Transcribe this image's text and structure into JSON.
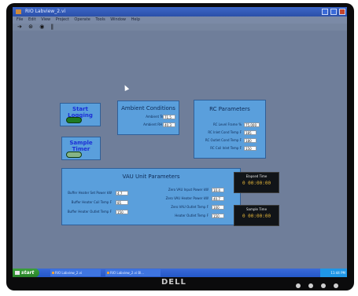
{
  "window": {
    "title": "RIO Labview_2.vi"
  },
  "menubar": [
    "File",
    "Edit",
    "View",
    "Project",
    "Operate",
    "Tools",
    "Window",
    "Help"
  ],
  "toolbar": [
    "➔",
    "⊛",
    "◉",
    "‖"
  ],
  "start_logging": {
    "label": "Start Logging",
    "state": true
  },
  "sample_timer": {
    "label": "Sample Timer",
    "state": false
  },
  "ambient": {
    "title": "Ambient Conditions",
    "rows": [
      {
        "label": "Ambient Temp",
        "value": "71.5"
      },
      {
        "label": "Ambient RH",
        "value": "40.3"
      }
    ]
  },
  "rc": {
    "title": "RC Parameters",
    "rows": [
      {
        "label": "RC Level Frame %",
        "value": "75.000"
      },
      {
        "label": "RC Inlet Cond Temp F",
        "value": "185"
      },
      {
        "label": "RC Outlet Cond Temp F",
        "value": "180"
      },
      {
        "label": "RC Coil Inlet Temp F",
        "value": "150"
      }
    ]
  },
  "vau": {
    "title": "VAU Unit Parameters",
    "left_rows": [
      {
        "label": "Buffer Heater Set Power kW",
        "value": "4.7"
      },
      {
        "label": "Buffer Heater Coil Temp F",
        "value": "85"
      },
      {
        "label": "Buffer Heater Outlet Temp F",
        "value": "150"
      }
    ],
    "right_rows": [
      {
        "label": "Zero VAU Input Power kW",
        "value": "10.4"
      },
      {
        "label": "Zero VAU Heater Power kW",
        "value": "40.7"
      },
      {
        "label": "Zero VAU Outlet Temp F",
        "value": "100"
      },
      {
        "label": "Heater Outlet Temp F",
        "value": "150"
      }
    ]
  },
  "elapsed": {
    "label": "Elapsed Time",
    "value": "0 00:00:00"
  },
  "sample": {
    "label": "Sample Time",
    "value": "0 00:00:00"
  },
  "taskbar": {
    "start": "start",
    "tasks": [
      "RIO Labview_2.vi",
      "RIO Labview_2.vi Bl..."
    ],
    "clock": "11:44 PM"
  },
  "brand": "DELL"
}
